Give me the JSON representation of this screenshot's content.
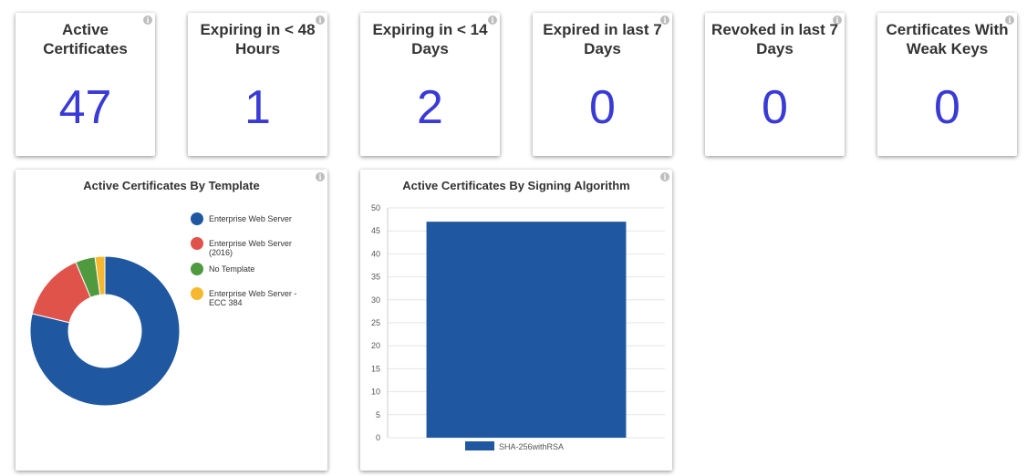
{
  "tiles": [
    {
      "title": "Active Certificates",
      "value": "47"
    },
    {
      "title": "Expiring in < 48 Hours",
      "value": "1"
    },
    {
      "title": "Expiring in < 14 Days",
      "value": "2"
    },
    {
      "title": "Expired in last 7 Days",
      "value": "0"
    },
    {
      "title": "Revoked in last 7 Days",
      "value": "0"
    },
    {
      "title": "Certificates With Weak Keys",
      "value": "0"
    }
  ],
  "info_glyph": "i",
  "template_chart": {
    "title": "Active Certificates By Template",
    "chart_data": {
      "type": "pie",
      "categories": [
        "Enterprise Web Server",
        "Enterprise Web Server (2016)",
        "No Template",
        "Enterprise Web Server - ECC 384"
      ],
      "values": [
        37,
        7,
        2,
        1
      ],
      "colors": [
        "#1f58a0",
        "#e0534a",
        "#4f9a3e",
        "#f5b82e"
      ]
    }
  },
  "algorithm_chart": {
    "title": "Active Certificates By Signing Algorithm",
    "chart_data": {
      "type": "bar",
      "categories": [
        "SHA-256withRSA"
      ],
      "series": [
        {
          "name": "SHA-256withRSA",
          "values": [
            47
          ]
        }
      ],
      "ylim": [
        0,
        50
      ],
      "yticks": [
        0,
        5,
        10,
        15,
        20,
        25,
        30,
        35,
        40,
        45,
        50
      ],
      "color": "#1f58a0"
    }
  }
}
